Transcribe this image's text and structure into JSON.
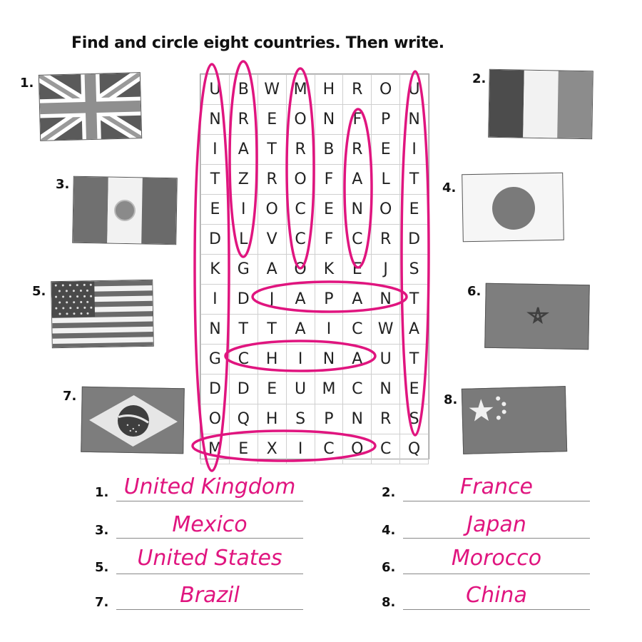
{
  "instruction": "Find and circle eight countries. Then write.",
  "flags": [
    {
      "num": "1.",
      "country_icon": "union-jack-flag"
    },
    {
      "num": "2.",
      "country_icon": "france-flag"
    },
    {
      "num": "3.",
      "country_icon": "mexico-flag"
    },
    {
      "num": "4.",
      "country_icon": "japan-flag"
    },
    {
      "num": "5.",
      "country_icon": "usa-flag"
    },
    {
      "num": "6.",
      "country_icon": "morocco-flag"
    },
    {
      "num": "7.",
      "country_icon": "brazil-flag"
    },
    {
      "num": "8.",
      "country_icon": "china-flag"
    }
  ],
  "grid": [
    [
      "U",
      "B",
      "W",
      "M",
      "H",
      "R",
      "O",
      "U"
    ],
    [
      "N",
      "R",
      "E",
      "O",
      "N",
      "F",
      "P",
      "N"
    ],
    [
      "I",
      "A",
      "T",
      "R",
      "B",
      "R",
      "E",
      "I"
    ],
    [
      "T",
      "Z",
      "R",
      "O",
      "F",
      "A",
      "L",
      "T"
    ],
    [
      "E",
      "I",
      "O",
      "C",
      "E",
      "N",
      "O",
      "E"
    ],
    [
      "D",
      "L",
      "V",
      "C",
      "F",
      "C",
      "R",
      "D"
    ],
    [
      "K",
      "G",
      "A",
      "O",
      "K",
      "E",
      "J",
      "S"
    ],
    [
      "I",
      "D",
      "J",
      "A",
      "P",
      "A",
      "N",
      "T"
    ],
    [
      "N",
      "T",
      "T",
      "A",
      "I",
      "C",
      "W",
      "A"
    ],
    [
      "G",
      "C",
      "H",
      "I",
      "N",
      "A",
      "U",
      "T"
    ],
    [
      "D",
      "D",
      "E",
      "U",
      "M",
      "C",
      "N",
      "E"
    ],
    [
      "O",
      "Q",
      "H",
      "S",
      "P",
      "N",
      "R",
      "S"
    ],
    [
      "M",
      "E",
      "X",
      "I",
      "C",
      "O",
      "C",
      "Q"
    ]
  ],
  "answers": [
    {
      "num": "1.",
      "text": "United Kingdom"
    },
    {
      "num": "2.",
      "text": "France"
    },
    {
      "num": "3.",
      "text": "Mexico"
    },
    {
      "num": "4.",
      "text": "Japan"
    },
    {
      "num": "5.",
      "text": "United States"
    },
    {
      "num": "6.",
      "text": "Morocco"
    },
    {
      "num": "7.",
      "text": "Brazil"
    },
    {
      "num": "8.",
      "text": "China"
    }
  ],
  "colors": {
    "accent": "#e0157f",
    "flag_dark": "#5a5a5a",
    "flag_mid": "#8a8a8a",
    "flag_light": "#eeeeee"
  }
}
